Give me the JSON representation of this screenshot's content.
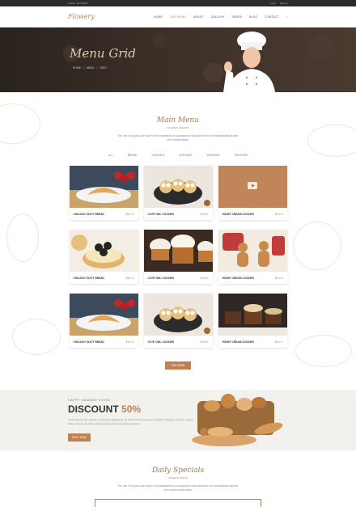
{
  "topbar": {
    "phone": "Hotline: 88-6-9837",
    "login": "Login",
    "signup": "Sign up",
    "cart": "🛒"
  },
  "nav": {
    "logo": "Flowery",
    "items": [
      "HOME",
      "OUR MENU",
      "ABOUT",
      "GALLERY",
      "PAGES",
      "BLOG",
      "CONTACT"
    ],
    "active": 1,
    "search": "⌕"
  },
  "hero": {
    "title": "Menu Grid",
    "breadcrumb": [
      "HOME",
      "/",
      "MENU",
      "/",
      "GRID"
    ]
  },
  "menu_section": {
    "title": "Main Menu",
    "subtitle": "FLOWERY BAKERY",
    "desc": "The role of a good cook ware in the preparation of a sumptuous meal cannot be over emphasized another one concept stellar.",
    "tabs": [
      "ALL",
      "BREAD",
      "COOKIES",
      "CUPCAKE",
      "WEDDING",
      "PASTRIES"
    ],
    "active_tab": 0,
    "items": [
      {
        "name": "CHICAGO TASTY BREAD",
        "price": "$12.9",
        "img": "croissant"
      },
      {
        "name": "CUTE OWL COOKIES",
        "price": "$16.5",
        "img": "owls"
      },
      {
        "name": "HONEY CREAM COOKIES",
        "price": "$11.0",
        "img": "video"
      },
      {
        "name": "CHICAGO TASTY BREAD",
        "price": "$12.9",
        "img": "tart"
      },
      {
        "name": "CUTE OWL COOKIES",
        "price": "$16.5",
        "img": "cupcakes"
      },
      {
        "name": "HONEY CREAM COOKIES",
        "price": "$11.0",
        "img": "gingerbread"
      },
      {
        "name": "CHICAGO TASTY BREAD",
        "price": "$12.9",
        "img": "croissant"
      },
      {
        "name": "CUTE OWL COOKIES",
        "price": "$16.5",
        "img": "owls"
      },
      {
        "name": "HONEY CREAM COOKIES",
        "price": "$11.0",
        "img": "cakes"
      }
    ],
    "more_button": "SEE MORE"
  },
  "promo": {
    "small": "HAPPY SUMMER EVENT",
    "discount_word": "DISCOUNT",
    "discount_value": "50%",
    "text": "Lorem ipsum dolor sit amet, consectetur adipisicing elit, sed do eiusmod tempor incididunt ut labore et dolore magna aliqua. Ut enim ad minim veniam, quis nostrud exercitation ullamco.",
    "button": "SHOP NOW"
  },
  "daily": {
    "title": "Daily Specials",
    "subtitle": "SWEETS BREAD",
    "desc": "The role of a good cook ware in the preparation of a sumptuous meal cannot be over emphasized another one concept stellar trend."
  },
  "colors": {
    "accent": "#c08150",
    "dark": "#2b2b2b"
  }
}
